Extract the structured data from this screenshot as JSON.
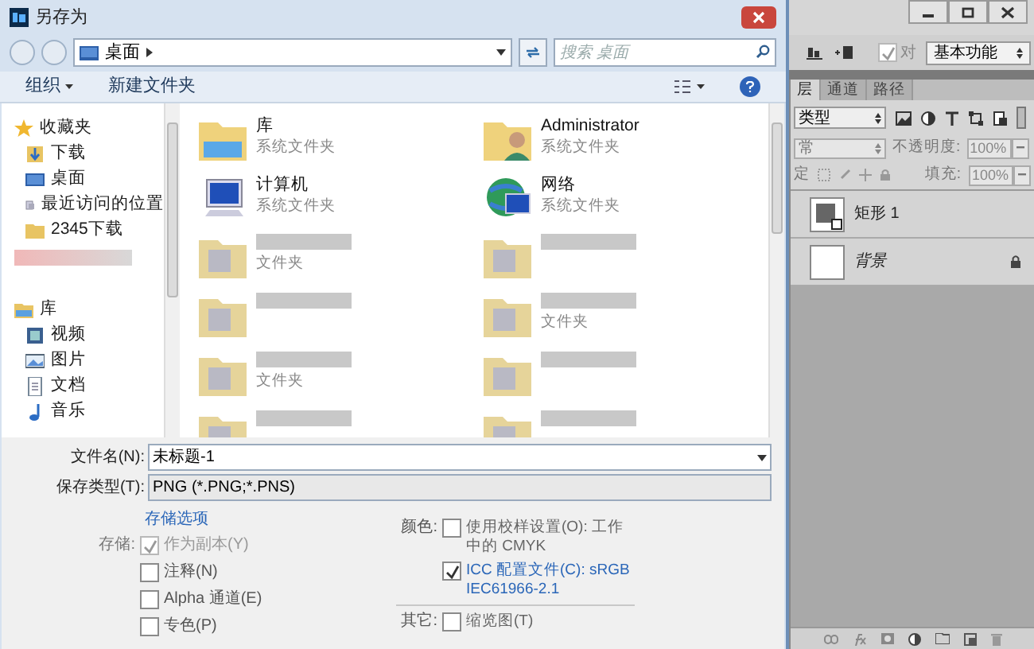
{
  "dialog": {
    "title": "另存为",
    "address": "桌面",
    "search": {
      "placeholder": "搜索 桌面"
    },
    "organize": "组织",
    "new_folder": "新建文件夹",
    "sidebar": [
      {
        "label": "收藏夹",
        "kind": "star",
        "children": [
          {
            "label": "下载",
            "kind": "download"
          },
          {
            "label": "桌面",
            "kind": "desktop"
          },
          {
            "label": "最近访问的位置",
            "kind": "recent"
          },
          {
            "label": "2345下载",
            "kind": "folder"
          },
          {
            "kind": "obscured"
          }
        ]
      },
      {
        "label": "库",
        "kind": "library",
        "children": [
          {
            "label": "视频",
            "kind": "video"
          },
          {
            "label": "图片",
            "kind": "picture"
          },
          {
            "label": "文档",
            "kind": "document"
          },
          {
            "label": "音乐",
            "kind": "music"
          }
        ]
      }
    ],
    "files": [
      {
        "kind": "library",
        "name": "库",
        "type": "系统文件夹"
      },
      {
        "kind": "user",
        "name": "Administrator",
        "type": "系统文件夹"
      },
      {
        "kind": "computer",
        "name": "计算机",
        "type": "系统文件夹"
      },
      {
        "kind": "network",
        "name": "网络",
        "type": "系统文件夹"
      },
      {
        "kind": "obscured",
        "type": "文件夹"
      },
      {
        "kind": "obscured"
      },
      {
        "kind": "obscured"
      },
      {
        "kind": "obscured",
        "type": "文件夹"
      },
      {
        "kind": "obscured",
        "type": "文件夹"
      },
      {
        "kind": "obscured"
      },
      {
        "kind": "obscured"
      },
      {
        "kind": "obscured"
      }
    ],
    "file_name": {
      "label": "文件名(N):",
      "value": "未标题-1"
    },
    "file_type": {
      "label": "保存类型(T):",
      "value": "PNG (*.PNG;*.PNS)"
    },
    "save_options": {
      "title": "存储选项",
      "save_label": "存储:",
      "save_checks": [
        {
          "label": "作为副本(Y)",
          "checked": true,
          "disabled": true
        },
        {
          "label": "注释(N)",
          "checked": false,
          "disabled": false
        },
        {
          "label": "Alpha 通道(E)",
          "checked": false,
          "disabled": false
        },
        {
          "label": "专色(P)",
          "checked": false,
          "disabled": false
        }
      ],
      "color_label": "颜色:",
      "color_checks": [
        {
          "label": "使用校样设置(O): 工作中的 CMYK",
          "checked": false,
          "kind": "plain"
        },
        {
          "label": "ICC 配置文件(C): sRGB IEC61966-2.1",
          "checked": true,
          "kind": "link"
        }
      ],
      "other_label": "其它:",
      "other_checks": [
        {
          "label": "缩览图(T)",
          "checked": false,
          "kind": "plain"
        }
      ]
    }
  },
  "photoshop": {
    "checkbox_label": "对",
    "checkbox_checked": true,
    "workspace": "基本功能",
    "tabs": [
      {
        "label": "层",
        "selected": true
      },
      {
        "label": "通道",
        "selected": false
      },
      {
        "label": "路径",
        "selected": false
      }
    ],
    "filter": "类型",
    "blend_mode": "常",
    "opacity_label": "不透明度:",
    "opacity": "100%",
    "lock_label": "定",
    "fill_label": "填充:",
    "fill": "100%",
    "layers": [
      {
        "name": "矩形 1",
        "kind": "shape",
        "locked": false
      },
      {
        "name": "背景",
        "kind": "background",
        "locked": true
      }
    ]
  }
}
